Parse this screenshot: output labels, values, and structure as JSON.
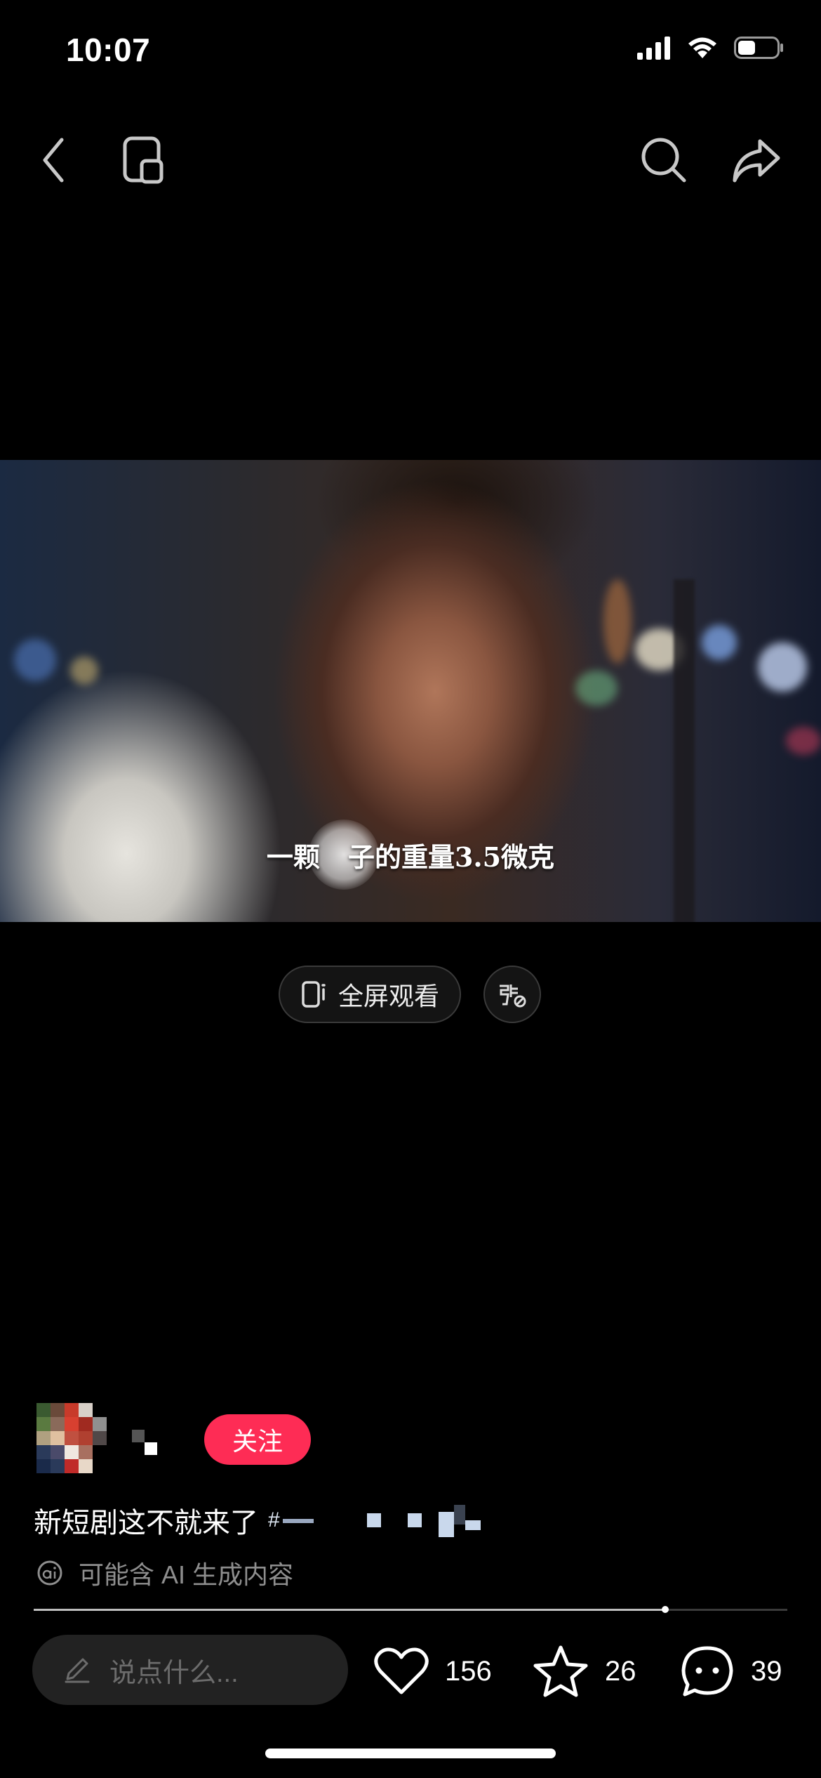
{
  "status_bar": {
    "time": "10:07"
  },
  "video": {
    "subtitle_left": "一颗",
    "subtitle_right": "子的重量3.5微克"
  },
  "controls": {
    "fullscreen_label": "全屏观看"
  },
  "author": {
    "follow_label": "关注"
  },
  "post": {
    "caption": "新短剧这不就来了",
    "hashtag_prefix": "#",
    "ai_notice": "可能含 AI 生成内容"
  },
  "playback": {
    "progress_fraction": 0.838
  },
  "bottom_bar": {
    "comment_placeholder": "说点什么...",
    "likes": "156",
    "favorites": "26",
    "comments": "39"
  },
  "colors": {
    "follow": "#fe2c55",
    "background": "#000000"
  }
}
